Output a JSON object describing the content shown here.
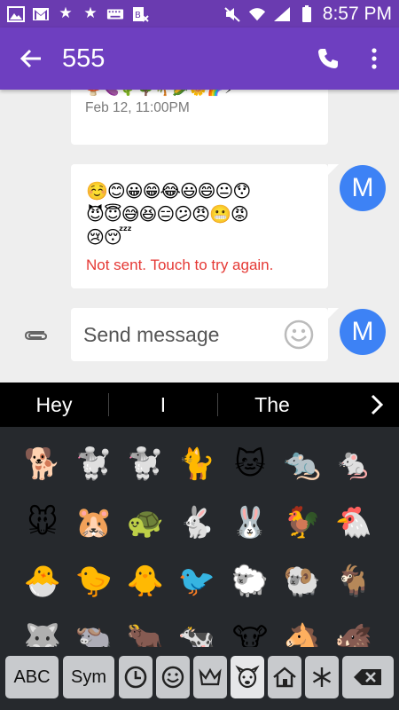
{
  "status_bar": {
    "time": "8:57 PM"
  },
  "app_bar": {
    "title": "555"
  },
  "messages": [
    {
      "emojis": "🍄🍆🌵🌳🌴🌽🌼🌈⚡",
      "timestamp": "Feb 12, 11:00PM"
    },
    {
      "emoji_rows": [
        "☺️😊😀😁😂😃😄😐😯",
        "😈😇😅😆😑😕😠😬😡",
        "😢😴"
      ],
      "status": "Not sent. Touch to try again.",
      "avatar_letter": "M"
    }
  ],
  "compose": {
    "placeholder": "Send message",
    "avatar_letter": "M"
  },
  "keyboard": {
    "suggestions": [
      "Hey",
      "I",
      "The"
    ],
    "emoji_rows": [
      [
        "🐕",
        "🐩",
        "🐩",
        "🐈",
        "🐱",
        "🐀",
        "🐁"
      ],
      [
        "🐭",
        "🐹",
        "🐢",
        "🐇",
        "🐰",
        "🐓",
        "🐔"
      ],
      [
        "🐣",
        "🐤",
        "🐥",
        "🐦",
        "🐑",
        "🐏",
        "🐐"
      ],
      [
        "🐺",
        "🐃",
        "🐂",
        "🐄",
        "🐮",
        "🐴",
        "🐗"
      ]
    ],
    "toolbar": {
      "abc": "ABC",
      "sym": "Sym"
    }
  },
  "colors": {
    "status_bar": "#6a3bb0",
    "app_bar": "#6e3fc0",
    "avatar": "#3d82f5",
    "error": "#e53935",
    "keyboard": "#26292d"
  },
  "icons": [
    "gallery-icon",
    "gmail-icon",
    "star-icon",
    "star-icon",
    "keyboard-icon",
    "blocked-icon",
    "mute-icon",
    "wifi-icon",
    "signal-icon",
    "battery-icon",
    "back-arrow-icon",
    "phone-icon",
    "more-vert-icon",
    "attach-icon",
    "smiley-icon",
    "chevron-right-icon",
    "recent-clock-icon",
    "face-icon",
    "crown-icon",
    "animal-icon",
    "house-icon",
    "snowflake-icon",
    "backspace-icon"
  ]
}
